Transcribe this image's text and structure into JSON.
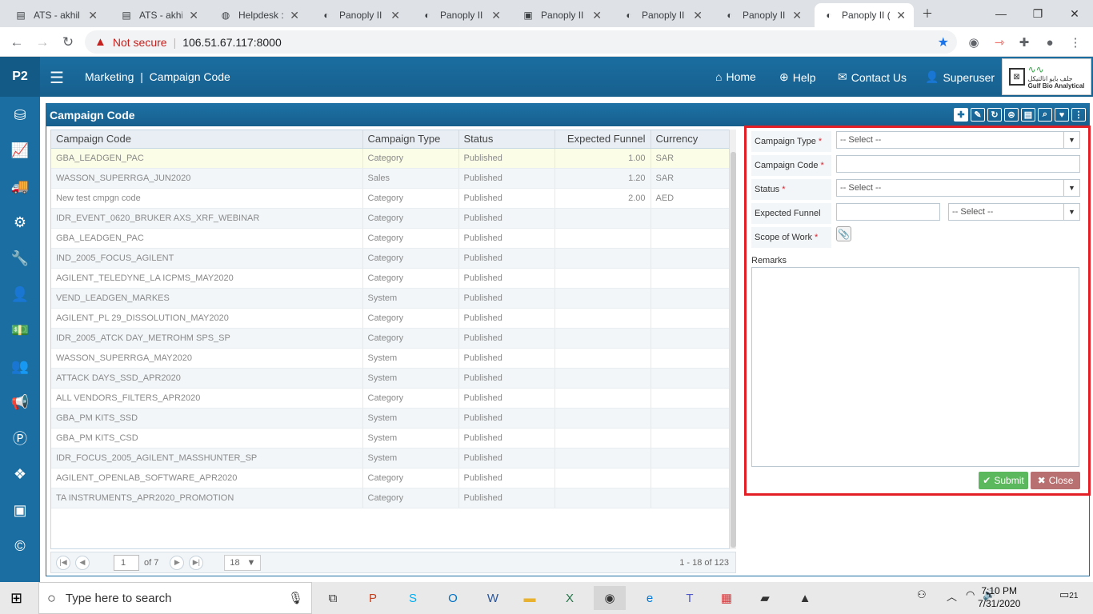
{
  "browser": {
    "tabs": [
      {
        "title": "ATS - akhil",
        "icon": "doc-icon"
      },
      {
        "title": "ATS - akhil",
        "icon": "doc-icon"
      },
      {
        "title": "Helpdesk : I",
        "icon": "helpdesk-icon"
      },
      {
        "title": "Panoply II (",
        "icon": "globe-icon"
      },
      {
        "title": "Panoply II (",
        "icon": "globe-icon"
      },
      {
        "title": "Panoply II (",
        "icon": "image-icon"
      },
      {
        "title": "Panoply II (",
        "icon": "globe-icon"
      },
      {
        "title": "Panoply II (",
        "icon": "globe-icon"
      },
      {
        "title": "Panoply II (",
        "icon": "globe-icon"
      }
    ],
    "security_label": "Not secure",
    "url": "106.51.67.117:8000"
  },
  "header": {
    "logo": "P2",
    "breadcrumb_module": "Marketing",
    "breadcrumb_page": "Campaign Code",
    "nav": {
      "home": "Home",
      "help": "Help",
      "contact": "Contact Us",
      "user": "Superuser"
    },
    "brand_arabic": "جلف بايو انالتيكل",
    "brand_name": "Gulf Bio Analytical"
  },
  "panel": {
    "title": "Campaign Code"
  },
  "grid": {
    "columns": [
      "Campaign Code",
      "Campaign Type",
      "Status",
      "Expected Funnel",
      "Currency"
    ],
    "rows": [
      [
        "GBA_LEADGEN_PAC",
        "Category",
        "Published",
        "1.00",
        "SAR"
      ],
      [
        "WASSON_SUPERRGA_JUN2020",
        "Sales",
        "Published",
        "1.20",
        "SAR"
      ],
      [
        "New test cmpgn code",
        "Category",
        "Published",
        "2.00",
        "AED"
      ],
      [
        "IDR_EVENT_0620_BRUKER AXS_XRF_WEBINAR",
        "Category",
        "Published",
        "",
        ""
      ],
      [
        "GBA_LEADGEN_PAC",
        "Category",
        "Published",
        "",
        ""
      ],
      [
        "IND_2005_FOCUS_AGILENT",
        "Category",
        "Published",
        "",
        ""
      ],
      [
        "AGILENT_TELEDYNE_LA ICPMS_MAY2020",
        "Category",
        "Published",
        "",
        ""
      ],
      [
        "VEND_LEADGEN_MARKES",
        "System",
        "Published",
        "",
        ""
      ],
      [
        "AGILENT_PL 29_DISSOLUTION_MAY2020",
        "Category",
        "Published",
        "",
        ""
      ],
      [
        "IDR_2005_ATCK DAY_METROHM SPS_SP",
        "Category",
        "Published",
        "",
        ""
      ],
      [
        "WASSON_SUPERRGA_MAY2020",
        "System",
        "Published",
        "",
        ""
      ],
      [
        "ATTACK DAYS_SSD_APR2020",
        "System",
        "Published",
        "",
        ""
      ],
      [
        "ALL VENDORS_FILTERS_APR2020",
        "Category",
        "Published",
        "",
        ""
      ],
      [
        "GBA_PM KITS_SSD",
        "System",
        "Published",
        "",
        ""
      ],
      [
        "GBA_PM KITS_CSD",
        "System",
        "Published",
        "",
        ""
      ],
      [
        "IDR_FOCUS_2005_AGILENT_MASSHUNTER_SP",
        "System",
        "Published",
        "",
        ""
      ],
      [
        "AGILENT_OPENLAB_SOFTWARE_APR2020",
        "Category",
        "Published",
        "",
        ""
      ],
      [
        "TA INSTRUMENTS_APR2020_PROMOTION",
        "Category",
        "Published",
        "",
        ""
      ]
    ]
  },
  "pager": {
    "page": "1",
    "of_pages": "of 7",
    "page_size": "18",
    "info": "1 - 18 of 123"
  },
  "form": {
    "campaign_type_label": "Campaign Type",
    "campaign_type_value": "-- Select --",
    "campaign_code_label": "Campaign Code",
    "status_label": "Status",
    "status_value": "-- Select --",
    "expected_funnel_label": "Expected Funnel",
    "currency_value": "-- Select --",
    "scope_label": "Scope of Work",
    "remarks_label": "Remarks",
    "required_mark": "*",
    "submit_label": "Submit",
    "close_label": "Close"
  },
  "taskbar": {
    "search_placeholder": "Type here to search",
    "time": "7:10 PM",
    "date": "7/31/2020",
    "notification_count": "21"
  }
}
